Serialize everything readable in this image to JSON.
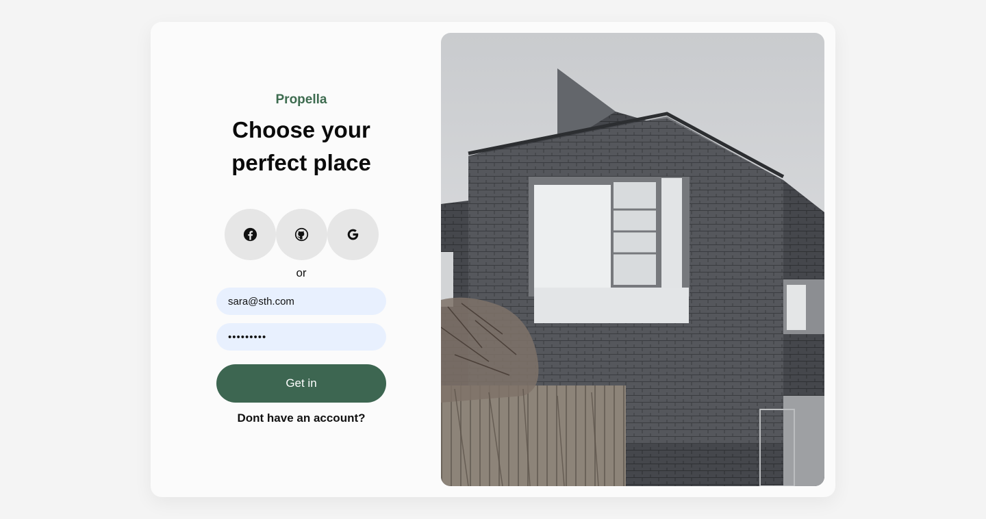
{
  "brand": "Propella",
  "headline": {
    "line1": "Choose your",
    "line2": "perfect place"
  },
  "social_buttons": [
    {
      "icon": "facebook-icon"
    },
    {
      "icon": "github-icon"
    },
    {
      "icon": "google-icon"
    }
  ],
  "divider_text": "or",
  "form": {
    "email_value": "sara@sth.com",
    "password_value": "•••••••••",
    "submit_label": "Get in",
    "signup_link": "Dont have an account?"
  },
  "colors": {
    "accent": "#3d6651",
    "brand_text": "#3d6b4f",
    "input_bg": "#e8f0fe",
    "social_bg": "#e6e6e6"
  },
  "image": {
    "subject": "modern-gray-brick-house-photo"
  }
}
